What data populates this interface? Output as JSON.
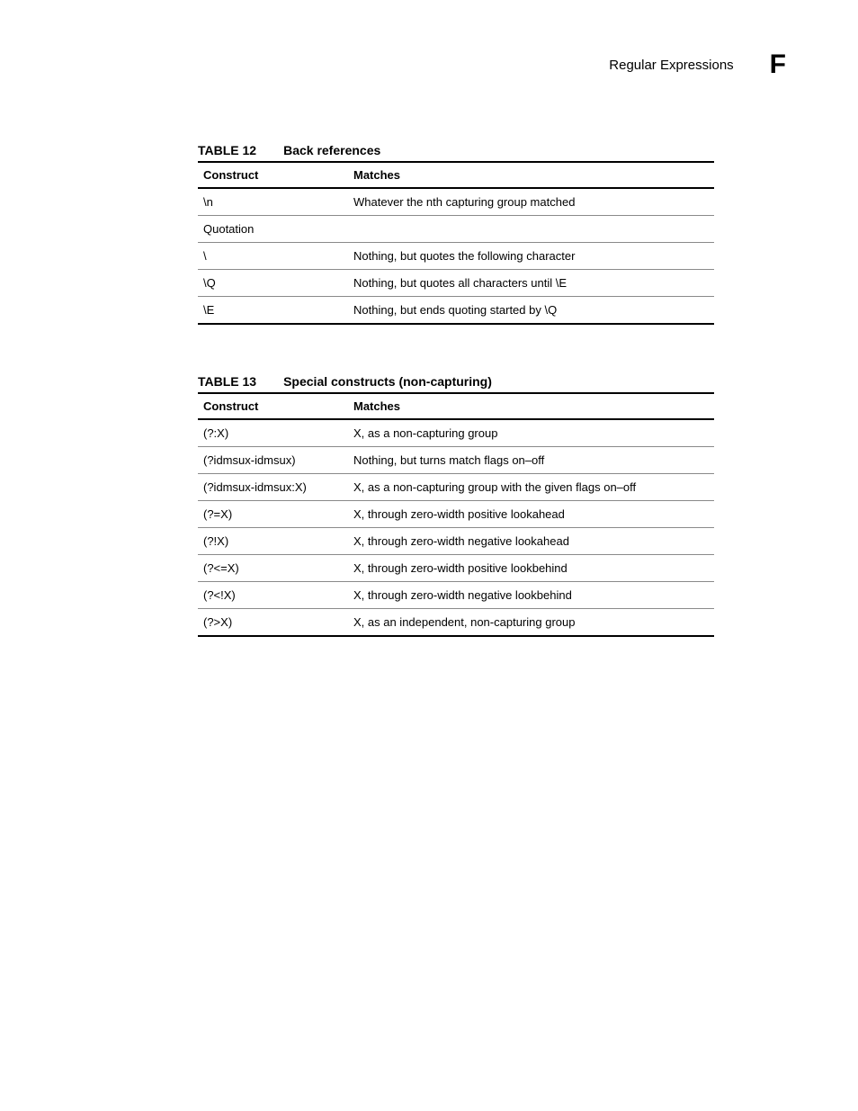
{
  "header": {
    "title": "Regular Expressions",
    "letter": "F"
  },
  "tables": [
    {
      "label": "TABLE 12",
      "title": "Back references",
      "columns": [
        "Construct",
        "Matches"
      ],
      "rows": [
        {
          "cells": [
            "\\n",
            "Whatever the nth capturing group matched"
          ]
        },
        {
          "span": "Quotation"
        },
        {
          "cells": [
            "\\",
            "Nothing, but quotes the following character"
          ]
        },
        {
          "cells": [
            "\\Q",
            "Nothing, but quotes all characters until \\E"
          ]
        },
        {
          "cells": [
            "\\E",
            "Nothing, but ends quoting started by \\Q"
          ]
        }
      ]
    },
    {
      "label": "TABLE 13",
      "title": "Special constructs (non-capturing)",
      "columns": [
        "Construct",
        "Matches"
      ],
      "rows": [
        {
          "cells": [
            "(?:X)",
            "X, as a non-capturing group"
          ]
        },
        {
          "cells": [
            "(?idmsux-idmsux)",
            "Nothing, but turns match flags on–off"
          ]
        },
        {
          "cells": [
            "(?idmsux-idmsux:X)",
            "X, as a non-capturing group with the given flags on–off"
          ]
        },
        {
          "cells": [
            "(?=X)",
            "X, through zero-width positive lookahead"
          ]
        },
        {
          "cells": [
            "(?!X)",
            "X, through zero-width negative lookahead"
          ]
        },
        {
          "cells": [
            "(?<=X)",
            "X, through zero-width positive lookbehind"
          ]
        },
        {
          "cells": [
            "(?<!X)",
            "X, through zero-width negative lookbehind"
          ]
        },
        {
          "cells": [
            "(?>X)",
            "X, as an independent, non-capturing group"
          ]
        }
      ]
    }
  ]
}
